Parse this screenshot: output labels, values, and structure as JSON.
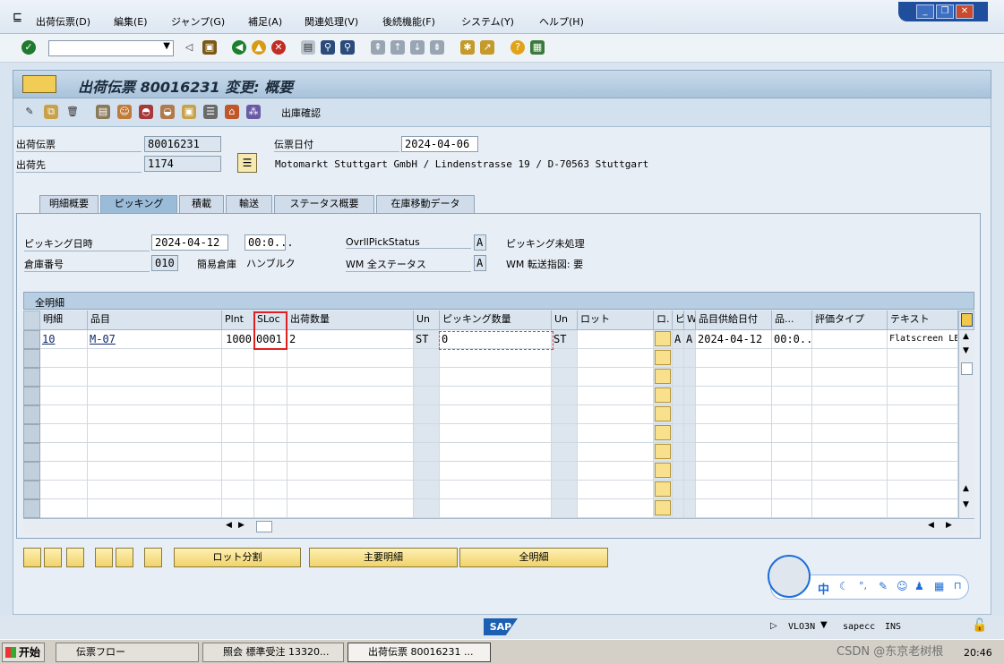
{
  "menu": [
    "出荷伝票(D)",
    "編集(E)",
    "ジャンプ(G)",
    "補足(A)",
    "関連処理(V)",
    "後続機能(F)",
    "システム(Y)",
    "ヘルプ(H)"
  ],
  "window_controls": [
    "_",
    "❐",
    "✕"
  ],
  "title": "出荷伝票 80016231 変更: 概要",
  "apptoolbar": {
    "outbound_confirm": "出庫確認"
  },
  "header": {
    "delivery_label": "出荷伝票",
    "delivery_value": "80016231",
    "doc_date_label": "伝票日付",
    "doc_date_value": "2024-04-06",
    "shipto_label": "出荷先",
    "shipto_value": "1174",
    "shipto_address": "Motomarkt Stuttgart GmbH / Lindenstrasse 19 / D-70563 Stuttgart"
  },
  "tabs": [
    "明細概要",
    "ピッキング",
    "積載",
    "輸送",
    "ステータス概要",
    "在庫移動データ"
  ],
  "picking": {
    "pick_date_label": "ピッキング日時",
    "pick_date": "2024-04-12",
    "pick_time": "00:0...",
    "overall_label": "OvrllPickStatus",
    "overall_value": "A",
    "overall_text": "ピッキング未処理",
    "warehouse_label": "倉庫番号",
    "warehouse_value": "010",
    "simple_wh_label": "簡易倉庫",
    "simple_wh_value": "ハンブルク",
    "wm_label": "WM 全ステータス",
    "wm_value": "A",
    "wm_text": "WM 転送指図: 要"
  },
  "table": {
    "title": "全明細",
    "columns": [
      "明細",
      "品目",
      "Plnt",
      "SLoc",
      "出荷数量",
      "Un",
      "ピッキング数量",
      "Un",
      "ロット",
      "ロ.",
      "ピ",
      "W.",
      "品目供給日付",
      "品...",
      "評価タイプ",
      "テキスト"
    ],
    "row": {
      "item": "10",
      "material": "M-07",
      "plant": "1000",
      "sloc": "0001",
      "qty": "2",
      "un": "ST",
      "pick_qty": "0",
      "un2": "ST",
      "lot": "",
      "c1": "A",
      "c2": "A",
      "date": "2024-04-12",
      "time": "00:0...",
      "val_type": "",
      "text": "Flatscreen LE"
    }
  },
  "buttons": {
    "batch_split": "ロット分割",
    "main_items": "主要明細",
    "all_items": "全明細"
  },
  "ime": {
    "label": "中"
  },
  "status": {
    "brand": "SAP",
    "tcode": "VLO3N",
    "system": "sapecc",
    "mode": "INS"
  },
  "taskbar": {
    "start": "开始",
    "tasks": [
      "伝票フロー",
      "照会 標準受注 13320...",
      "出荷伝票 80016231 ..."
    ],
    "clock": "20:46",
    "watermark": "CSDN @东京老树根"
  }
}
